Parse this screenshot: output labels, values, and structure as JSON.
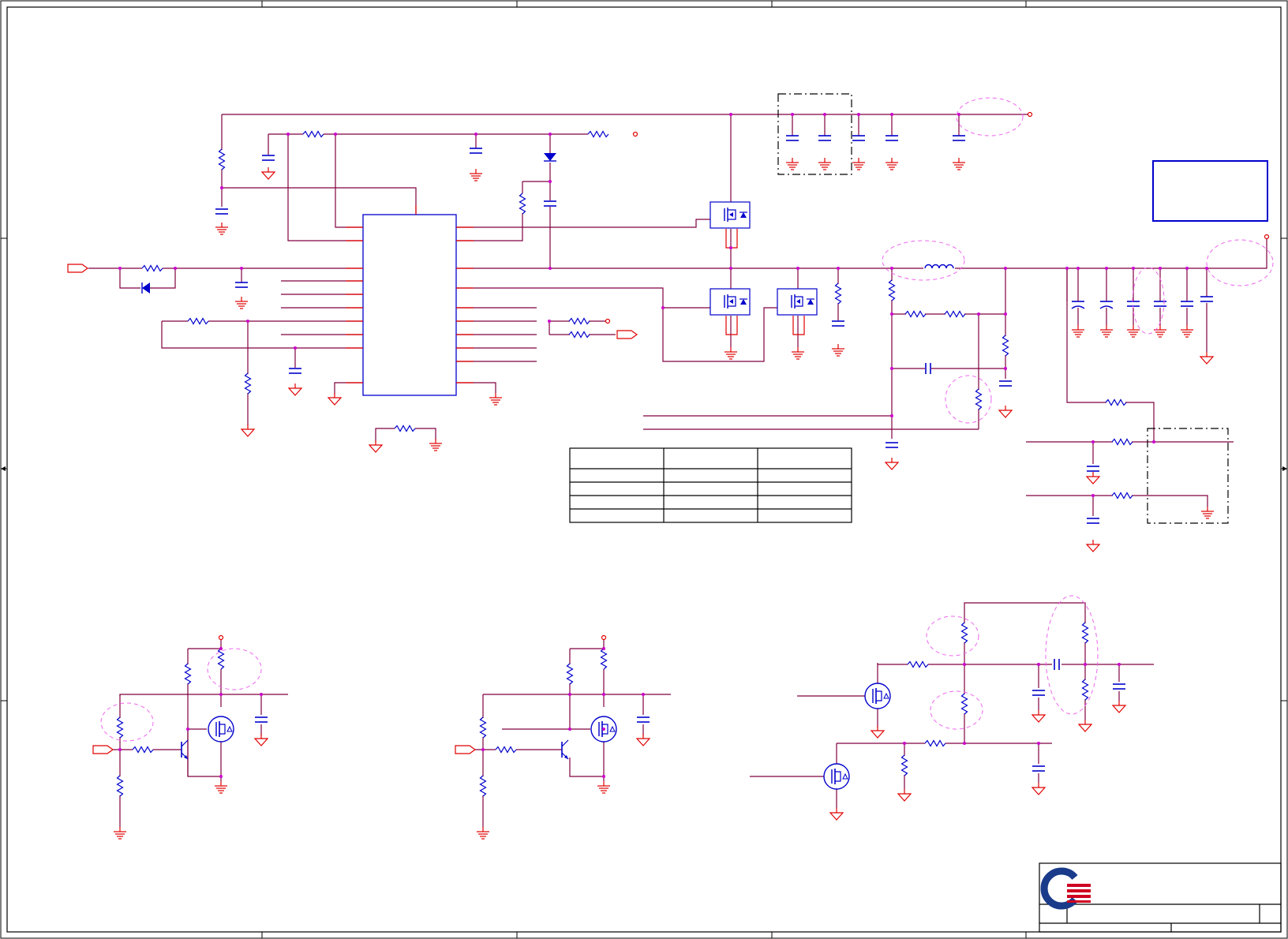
{
  "sheet": {
    "background": "#ffffff",
    "wire_color": "#800040",
    "pin_color": "#e00000",
    "part_color": "#0000cc",
    "junction_color": "#cc00cc",
    "annotation_color": "#ee66ee",
    "border_color": "#000000"
  },
  "title_block": {
    "logo": "company-logo",
    "logo_colors": [
      "#1a3a8a",
      "#d00020"
    ]
  }
}
